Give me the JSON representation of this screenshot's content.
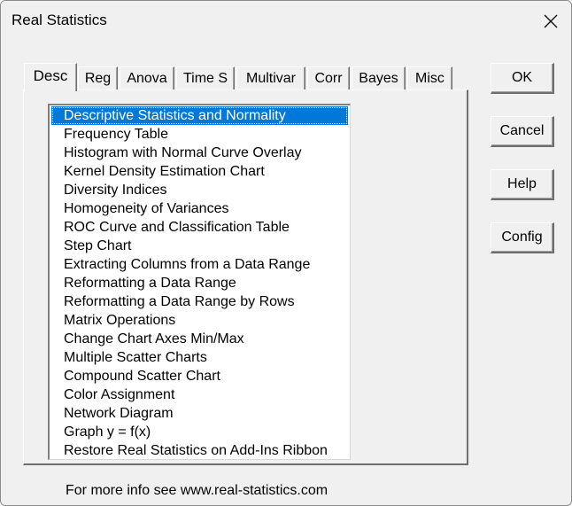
{
  "window": {
    "title": "Real Statistics"
  },
  "tabs": [
    {
      "label": "Desc",
      "active": true
    },
    {
      "label": "Reg",
      "active": false
    },
    {
      "label": "Anova",
      "active": false
    },
    {
      "label": "Time S",
      "active": false
    },
    {
      "label": "Multivar",
      "active": false
    },
    {
      "label": "Corr",
      "active": false
    },
    {
      "label": "Bayes",
      "active": false
    },
    {
      "label": "Misc",
      "active": false
    }
  ],
  "list": {
    "selected_index": 0,
    "items": [
      "Descriptive Statistics and Normality",
      "Frequency Table",
      "Histogram with Normal Curve Overlay",
      "Kernel Density Estimation Chart",
      "Diversity Indices",
      "Homogeneity of Variances",
      "ROC Curve and Classification Table",
      "Step Chart",
      "Extracting Columns from a Data Range",
      "Reformatting a Data Range",
      "Reformatting a Data Range by Rows",
      "Matrix Operations",
      "Change Chart Axes Min/Max",
      "Multiple Scatter Charts",
      "Compound Scatter Chart",
      "Color Assignment",
      "Network Diagram",
      "Graph y = f(x)",
      "Restore Real Statistics on Add-Ins Ribbon"
    ]
  },
  "buttons": {
    "ok": "OK",
    "cancel": "Cancel",
    "help": "Help",
    "config": "Config"
  },
  "footer": {
    "text": "For more info see www.real-statistics.com"
  },
  "colors": {
    "selection": "#0078d7",
    "dialog_bg": "#f0f0f0"
  }
}
